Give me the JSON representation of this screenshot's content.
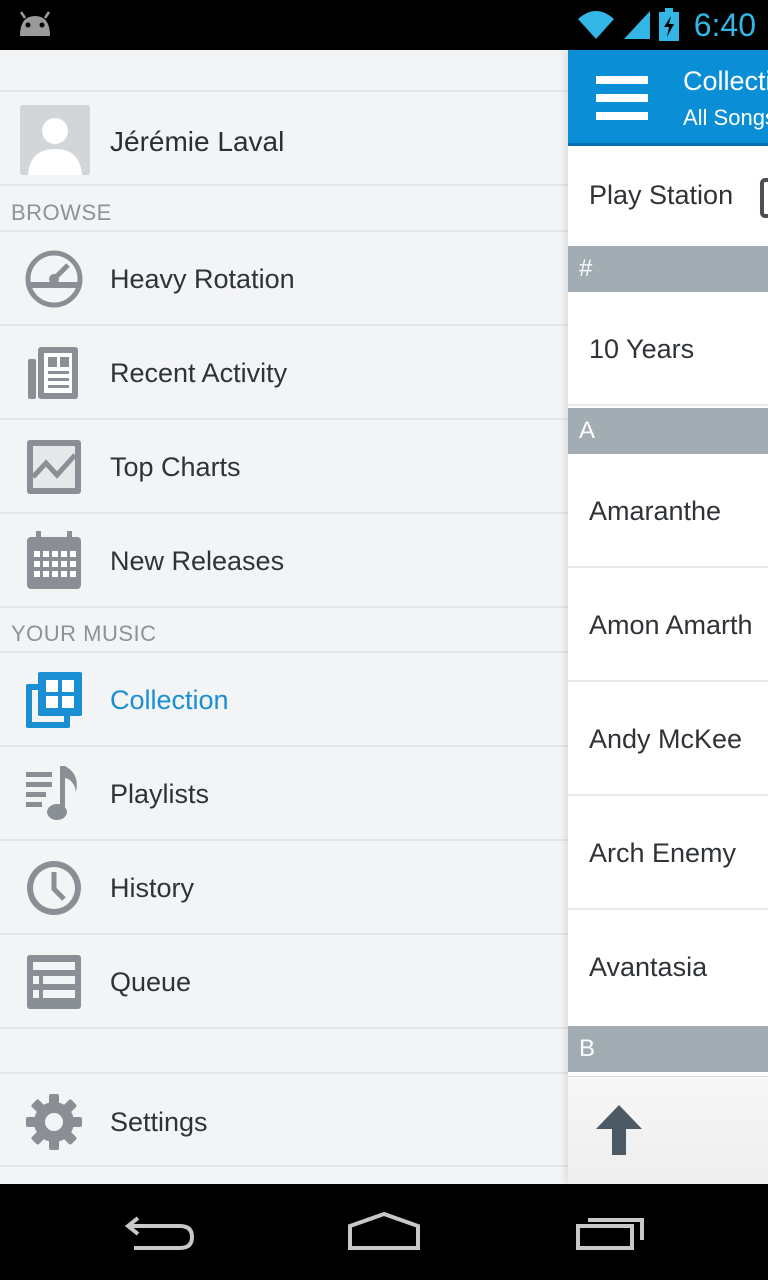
{
  "status_bar": {
    "time": "6:40",
    "icons": [
      "android-debug-icon",
      "wifi-icon",
      "signal-icon",
      "battery-charging-icon"
    ]
  },
  "drawer": {
    "profile_name": "Jérémie Laval",
    "browse_header": "BROWSE",
    "browse_items": [
      {
        "label": "Heavy Rotation",
        "icon": "gauge-icon"
      },
      {
        "label": "Recent Activity",
        "icon": "newspaper-icon"
      },
      {
        "label": "Top Charts",
        "icon": "chart-icon"
      },
      {
        "label": "New Releases",
        "icon": "calendar-icon"
      }
    ],
    "your_music_header": "YOUR MUSIC",
    "music_items": [
      {
        "label": "Collection",
        "icon": "collection-icon",
        "active": true
      },
      {
        "label": "Playlists",
        "icon": "playlist-icon"
      },
      {
        "label": "History",
        "icon": "clock-icon"
      },
      {
        "label": "Queue",
        "icon": "queue-icon"
      }
    ],
    "settings_label": "Settings",
    "accent_color": "#1a8fd3"
  },
  "content": {
    "title": "Collection",
    "subtitle": "All Songs",
    "play_station": "Play Station",
    "sections": [
      {
        "letter": "#",
        "artists": [
          "10 Years"
        ]
      },
      {
        "letter": "A",
        "artists": [
          "Amaranthe",
          "Amon Amarth",
          "Andy McKee",
          "Arch Enemy",
          "Avantasia"
        ]
      },
      {
        "letter": "B",
        "artists": []
      }
    ],
    "actionbar_color": "#0a8fd6"
  },
  "nav_buttons": [
    "back-icon",
    "home-icon",
    "recents-icon"
  ]
}
